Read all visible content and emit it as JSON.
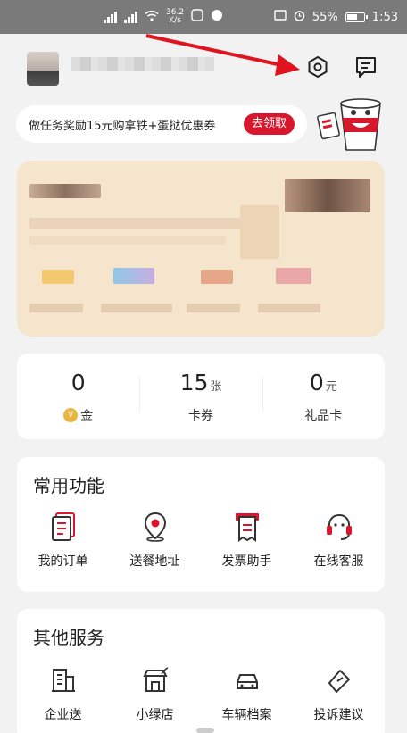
{
  "status_bar": {
    "net_speed": "36.2",
    "net_unit": "K/s",
    "battery": "55%",
    "time": "1:53"
  },
  "header": {
    "settings_icon": "settings-hexagon-icon",
    "message_icon": "message-icon"
  },
  "promo": {
    "text": "做任务奖励15元购拿铁+蛋挞优惠券",
    "button": "去领取"
  },
  "stats": [
    {
      "value": "0",
      "unit": "",
      "label": "金",
      "icon": "v-coin-icon"
    },
    {
      "value": "15",
      "unit": "张",
      "label": "卡券"
    },
    {
      "value": "0",
      "unit": "元",
      "label": "礼品卡"
    }
  ],
  "common_functions": {
    "title": "常用功能",
    "items": [
      {
        "label": "我的订单",
        "icon": "order-list-icon"
      },
      {
        "label": "送餐地址",
        "icon": "location-pin-icon"
      },
      {
        "label": "发票助手",
        "icon": "invoice-icon"
      },
      {
        "label": "在线客服",
        "icon": "headset-icon"
      }
    ]
  },
  "other_services": {
    "title": "其他服务",
    "items": [
      {
        "label": "企业送",
        "icon": "building-icon"
      },
      {
        "label": "小绿店",
        "icon": "green-store-icon"
      },
      {
        "label": "车辆档案",
        "icon": "car-icon"
      },
      {
        "label": "投诉建议",
        "icon": "feedback-tag-icon"
      }
    ]
  },
  "colors": {
    "accent": "#d9172c",
    "card": "#f5e5cc",
    "status_bar": "#7a7a7a"
  }
}
